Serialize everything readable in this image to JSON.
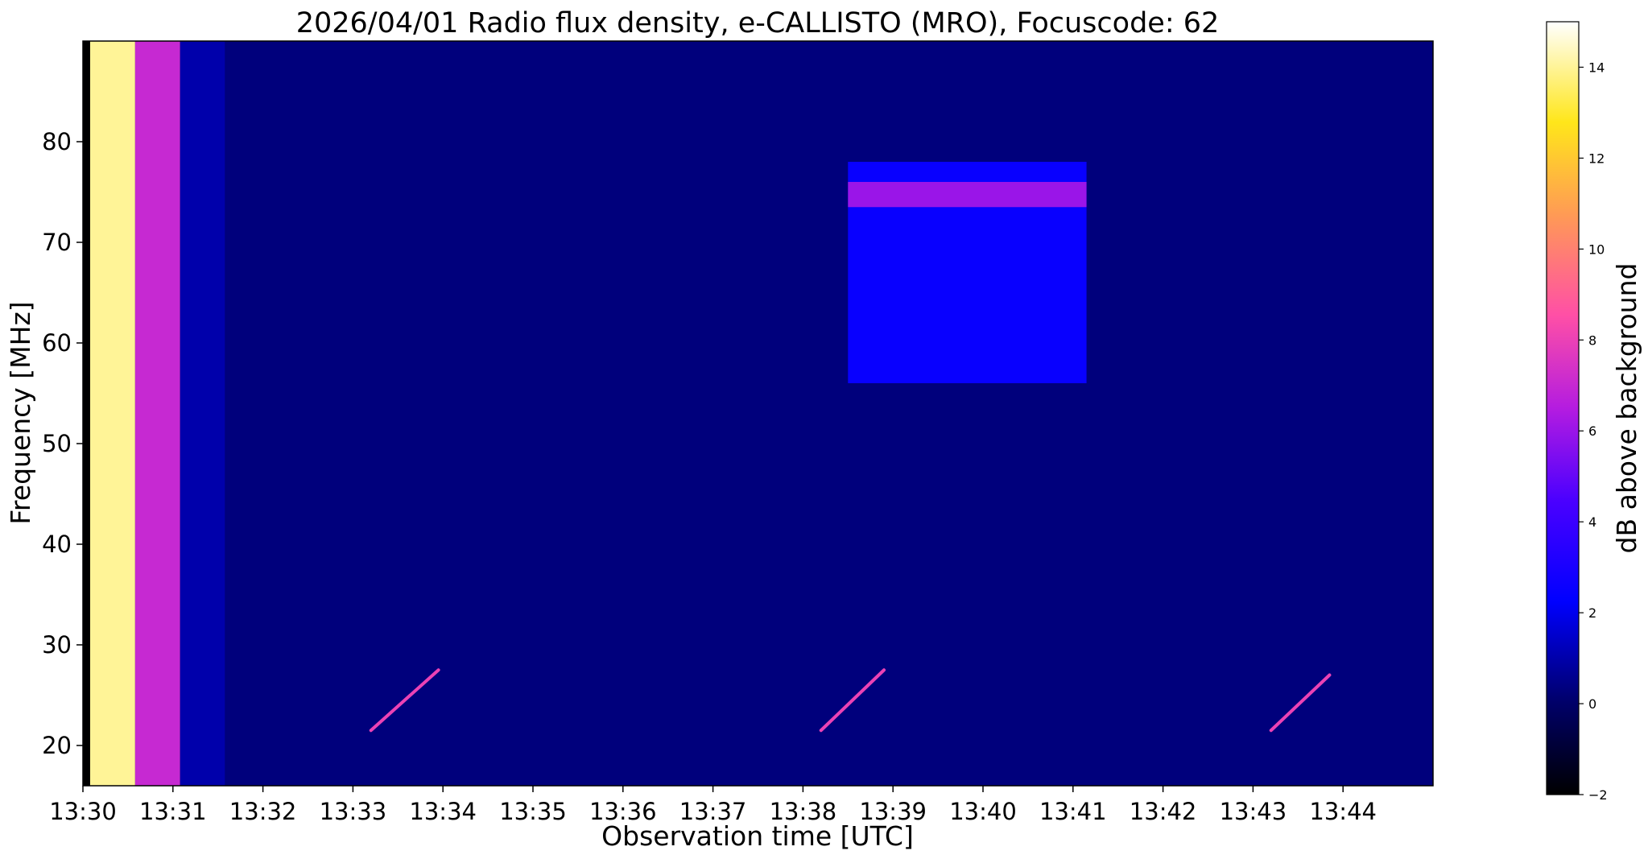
{
  "chart_data": {
    "type": "heatmap",
    "title": "2026/04/01  Radio flux density, e-CALLISTO (MRO), Focuscode: 62",
    "xlabel": "Observation time [UTC]",
    "ylabel": "Frequency [MHz]",
    "x_unit": "minutes past 13:30 UTC",
    "xlim": [
      0,
      15
    ],
    "ylim": [
      16,
      90
    ],
    "x_ticks": [
      0,
      1,
      2,
      3,
      4,
      5,
      6,
      7,
      8,
      9,
      10,
      11,
      12,
      13,
      14
    ],
    "x_tick_labels": [
      "13:30",
      "13:31",
      "13:32",
      "13:33",
      "13:34",
      "13:35",
      "13:36",
      "13:37",
      "13:38",
      "13:39",
      "13:40",
      "13:41",
      "13:42",
      "13:43",
      "13:44"
    ],
    "y_ticks": [
      20,
      30,
      40,
      50,
      60,
      70,
      80
    ],
    "y_tick_labels": [
      "20",
      "30",
      "40",
      "50",
      "60",
      "70",
      "80"
    ],
    "colorbar": {
      "label": "dB above background",
      "range": [
        -2,
        15
      ],
      "ticks": [
        -2,
        0,
        2,
        4,
        6,
        8,
        10,
        12,
        14
      ],
      "tick_labels": [
        "−2",
        "0",
        "2",
        "4",
        "6",
        "8",
        "10",
        "12",
        "14"
      ],
      "colormap": "gnuplot2"
    },
    "regions": [
      {
        "t0": 0.0,
        "t1": 0.08,
        "f0": 16,
        "f1": 90,
        "db": -2
      },
      {
        "t0": 0.08,
        "t1": 0.58,
        "f0": 16,
        "f1": 90,
        "db": 14
      },
      {
        "t0": 0.58,
        "t1": 1.08,
        "f0": 16,
        "f1": 90,
        "db": 7
      },
      {
        "t0": 1.08,
        "t1": 1.58,
        "f0": 16,
        "f1": 90,
        "db": 1
      },
      {
        "t0": 1.58,
        "t1": 15.0,
        "f0": 16,
        "f1": 90,
        "db": 0.3
      },
      {
        "t0": 8.5,
        "t1": 11.15,
        "f0": 56,
        "f1": 78,
        "db": 2.5
      },
      {
        "t0": 8.5,
        "t1": 11.15,
        "f0": 73.5,
        "f1": 76,
        "db": 6
      }
    ],
    "bursts": [
      {
        "t0": 3.2,
        "t1": 3.95,
        "f0": 21.5,
        "f1": 27.5,
        "db": 8
      },
      {
        "t0": 8.2,
        "t1": 8.9,
        "f0": 21.5,
        "f1": 27.5,
        "db": 8
      },
      {
        "t0": 13.2,
        "t1": 13.85,
        "f0": 21.5,
        "f1": 27.0,
        "db": 8
      }
    ],
    "grid": false
  }
}
